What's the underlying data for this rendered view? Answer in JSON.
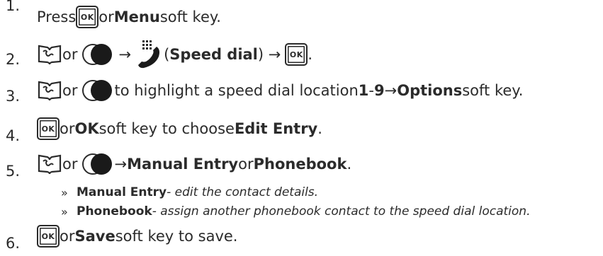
{
  "steps": [
    {
      "num": "1.",
      "a": "Press ",
      "b": " or ",
      "menu": "Menu",
      "c": " soft key."
    },
    {
      "num": "2.",
      "or": " or ",
      "arrow1": "→",
      "open": " (",
      "speed": "Speed dial",
      "close": ") →",
      "end": "."
    },
    {
      "num": "3.",
      "or": " or ",
      "a": " to highlight a speed dial location ",
      "one": "1",
      "dash": " - ",
      "nine": "9",
      "arrow": " → ",
      "options": "Options",
      "c": " soft key."
    },
    {
      "num": "4.",
      "a": " or ",
      "ok": "OK",
      "b": " soft key to choose ",
      "edit": "Edit Entry",
      "c": "."
    },
    {
      "num": "5.",
      "or": " or ",
      "arrow": " → ",
      "manual": "Manual Entry",
      "mid": " or ",
      "phonebook": "Phonebook",
      "c": "."
    },
    {
      "num": "6.",
      "a": " or ",
      "save": "Save",
      "c": " soft key to save."
    }
  ],
  "sub": [
    {
      "q": "»",
      "bold": "Manual Entry",
      "rest": " - edit the contact details."
    },
    {
      "q": "»",
      "bold": "Phonebook",
      "rest": " - assign another phonebook contact to the speed dial location."
    }
  ],
  "icons": {
    "ok_key_label": "OK",
    "nav_icon": "book-nav-icon",
    "circle_icon": "round-nav-icon",
    "speed_icon": "speed-dial-icon"
  }
}
